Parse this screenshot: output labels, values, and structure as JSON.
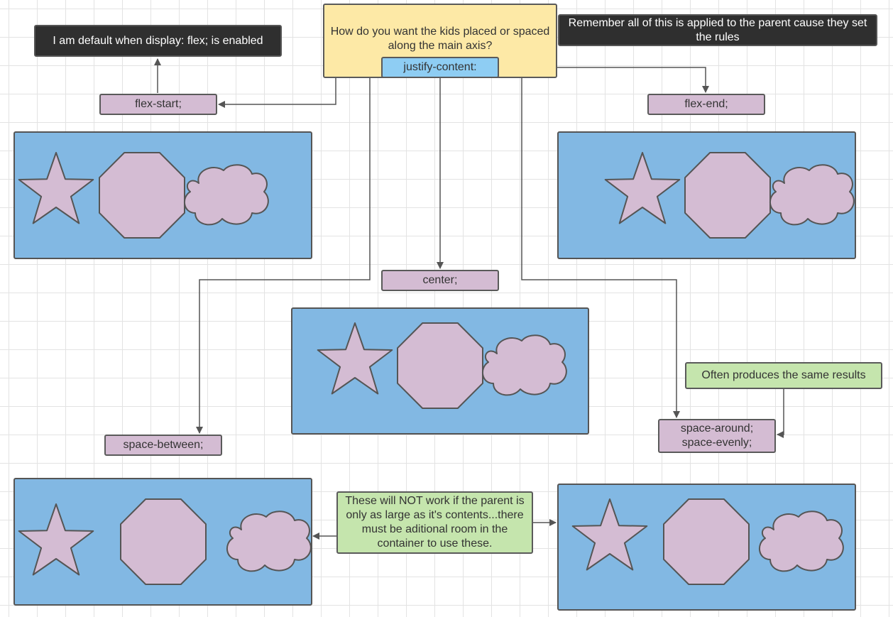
{
  "notes": {
    "default_note": "I am default when display: flex; is enabled",
    "question": "How do you want the kids placed or spaced along the main axis?",
    "property": "justify-content:",
    "remember": "Remember all of this is applied to the parent cause they set the rules",
    "same_results": "Often produces the same results",
    "warning": "These will NOT work if the parent is only as large as it's contents...there must be aditional room in the container to use these."
  },
  "values": {
    "flex_start": "flex-start;",
    "flex_end": "flex-end;",
    "center": "center;",
    "space_between": "space-between;",
    "space_around": "space-around;",
    "space_evenly": "space-evenly;"
  },
  "containers": [
    {
      "name": "flex-start",
      "children": [
        "star",
        "octagon",
        "cloud"
      ]
    },
    {
      "name": "flex-end",
      "children": [
        "star",
        "octagon",
        "cloud"
      ]
    },
    {
      "name": "center",
      "children": [
        "star",
        "octagon",
        "cloud"
      ]
    },
    {
      "name": "space-between",
      "children": [
        "star",
        "octagon",
        "cloud"
      ]
    },
    {
      "name": "space-around-evenly",
      "children": [
        "star",
        "octagon",
        "cloud"
      ]
    }
  ],
  "colors": {
    "container": "#82b8e3",
    "shape": "#d4bcd3",
    "question_box": "#fde9a6",
    "property_box": "#8ecdf3",
    "value_box": "#d4bcd3",
    "note_green": "#c5e5ad",
    "note_dark": "#2f2f2f"
  }
}
